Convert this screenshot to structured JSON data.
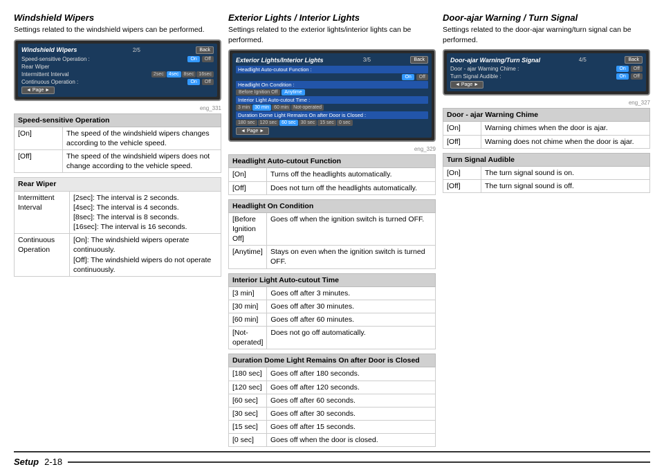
{
  "page": {
    "footer": {
      "setup_label": "Setup",
      "page_num": "2-18"
    }
  },
  "col1": {
    "title": "Windshield Wipers",
    "description": "Settings related to the windshield wipers can be performed.",
    "screen": {
      "title": "Windshield Wipers",
      "page": "2/5",
      "back": "Back",
      "caption": "eng_331",
      "rows": [
        {
          "label": "Speed-sensitive Operation :",
          "btn_on": "On",
          "btn_off": "Off"
        },
        {
          "label": "Rear Wiper",
          "value": ""
        },
        {
          "label": "Intermittent Interval",
          "intervals": [
            "2sec",
            "4sec",
            "8sec",
            "16sec"
          ]
        },
        {
          "label": "Continuous Operation :",
          "btn_on": "On",
          "btn_off": "Off"
        }
      ]
    },
    "tables": [
      {
        "header": "Speed-sensitive Operation",
        "rows": [
          {
            "label": "[On]",
            "text": "The speed of the windshield wipers changes according to the vehicle speed."
          },
          {
            "label": "[Off]",
            "text": "The speed of the windshield wipers does not change according to the vehicle speed."
          }
        ]
      },
      {
        "header": "Rear Wiper",
        "sub_rows": [
          {
            "label": "Intermittent Interval",
            "items": [
              "[2sec]: The interval is 2 seconds.",
              "[4sec]: The interval is 4 seconds.",
              "[8sec]: The interval is 8 seconds.",
              "[16sec]: The interval is 16 seconds."
            ]
          },
          {
            "label": "Continuous Operation",
            "items": [
              "[On]: The windshield wipers operate continuously.",
              "[Off]: The windshield wipers do not operate continuously."
            ]
          }
        ]
      }
    ]
  },
  "col2": {
    "title": "Exterior Lights / Interior Lights",
    "description": "Settings related to the exterior lights/interior lights can be performed.",
    "screen": {
      "title": "Exterior Lights/Interior Lights",
      "page": "3/5",
      "back": "Back",
      "caption": "eng_329"
    },
    "tables": [
      {
        "header": "Headlight Auto-cutout Function",
        "rows": [
          {
            "label": "[On]",
            "text": "Turns off the headlights automatically."
          },
          {
            "label": "[Off]",
            "text": "Does not turn off the headlights automatically."
          }
        ]
      },
      {
        "header": "Headlight On Condition",
        "rows": [
          {
            "label": "[Before Ignition Off]",
            "text": "Goes off when the ignition switch is turned OFF."
          },
          {
            "label": "[Anytime]",
            "text": "Stays on even when the ignition switch is turned OFF."
          }
        ]
      },
      {
        "header": "Interior Light Auto-cutout Time",
        "rows": [
          {
            "label": "[3 min]",
            "text": "Goes off after 3 minutes."
          },
          {
            "label": "[30 min]",
            "text": "Goes off after 30 minutes."
          },
          {
            "label": "[60 min]",
            "text": "Goes off after 60 minutes."
          },
          {
            "label": "[Not-operated]",
            "text": "Does not go off automatically."
          }
        ]
      },
      {
        "header": "Duration Dome Light Remains On after Door is Closed",
        "rows": [
          {
            "label": "[180 sec]",
            "text": "Goes off after 180 seconds."
          },
          {
            "label": "[120 sec]",
            "text": "Goes off after 120 seconds."
          },
          {
            "label": "[60 sec]",
            "text": "Goes off after 60 seconds."
          },
          {
            "label": "[30 sec]",
            "text": "Goes off after 30 seconds."
          },
          {
            "label": "[15 sec]",
            "text": "Goes off after 15 seconds."
          },
          {
            "label": "[0 sec]",
            "text": "Goes off when the door is closed."
          }
        ]
      }
    ]
  },
  "col3": {
    "title": "Door-ajar Warning / Turn Signal",
    "description": "Settings related to the door-ajar warning/turn signal can be performed.",
    "screen": {
      "title": "Door-ajar Warning/Turn Signal",
      "page": "4/5",
      "back": "Back",
      "caption": "eng_327",
      "rows": [
        {
          "label": "Door - ajar Warning Chime :",
          "btn_on": "On",
          "btn_off": "Off"
        },
        {
          "label": "Turn Signal Audible :",
          "btn_on": "On",
          "btn_off": "Off"
        }
      ]
    },
    "tables": [
      {
        "header": "Door - ajar Warning Chime",
        "rows": [
          {
            "label": "[On]",
            "text": "Warning chimes when the door is ajar."
          },
          {
            "label": "[Off]",
            "text": "Warning does not chime when the door is ajar."
          }
        ]
      },
      {
        "header": "Turn Signal Audible",
        "rows": [
          {
            "label": "[On]",
            "text": "The turn signal sound is on."
          },
          {
            "label": "[Off]",
            "text": "The turn signal sound is off."
          }
        ]
      }
    ]
  }
}
